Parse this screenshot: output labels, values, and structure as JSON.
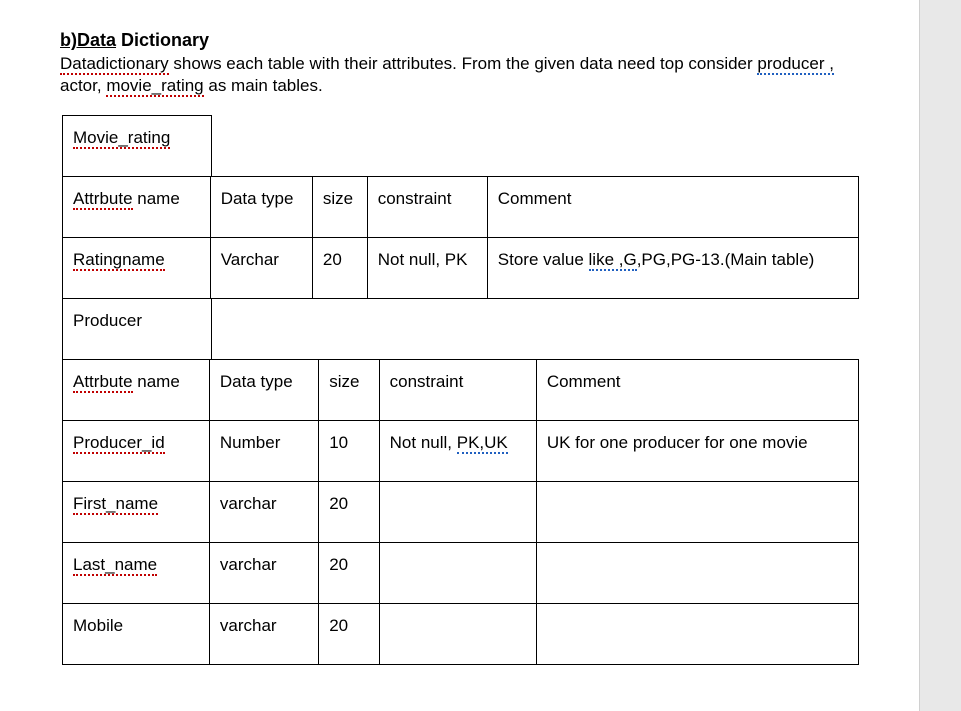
{
  "heading": {
    "prefix": "b)Data",
    "suffix": " Dictionary"
  },
  "intro": {
    "t1": "Datadictionary",
    "t2": " shows each table with their attributes. From the given data need top consider ",
    "t3": "producer ,",
    "t4": " actor, ",
    "t5": "movie_rating",
    "t6": " as main tables."
  },
  "table1": {
    "title": "Movie_rating",
    "h1": "Attrbute",
    "h1b": " name",
    "h2": "Data type",
    "h3": "size",
    "h4": "constraint",
    "h5": "Comment",
    "r1c1": "Ratingname",
    "r1c2": "Varchar",
    "r1c3": "20",
    "r1c4": "Not null, PK",
    "r1c5a": "Store value ",
    "r1c5b": "like ,G",
    "r1c5c": ",PG,PG-13.(Main table)"
  },
  "table2": {
    "title": "Producer",
    "h1": "Attrbute",
    "h1b": " name",
    "h2": "Data type",
    "h3": "size",
    "h4": "constraint",
    "h5": "Comment",
    "r1c1": "Producer_id",
    "r1c2": "Number",
    "r1c3": "10",
    "r1c4a": "Not null, ",
    "r1c4b": "PK,UK",
    "r1c5": "UK for one producer for one movie",
    "r2c1": "First_name",
    "r2c2": "varchar",
    "r2c3": "20",
    "r3c1": "Last_name",
    "r3c2": "varchar",
    "r3c3": "20",
    "r4c1": "Mobile",
    "r4c2": "varchar",
    "r4c3": "20"
  }
}
